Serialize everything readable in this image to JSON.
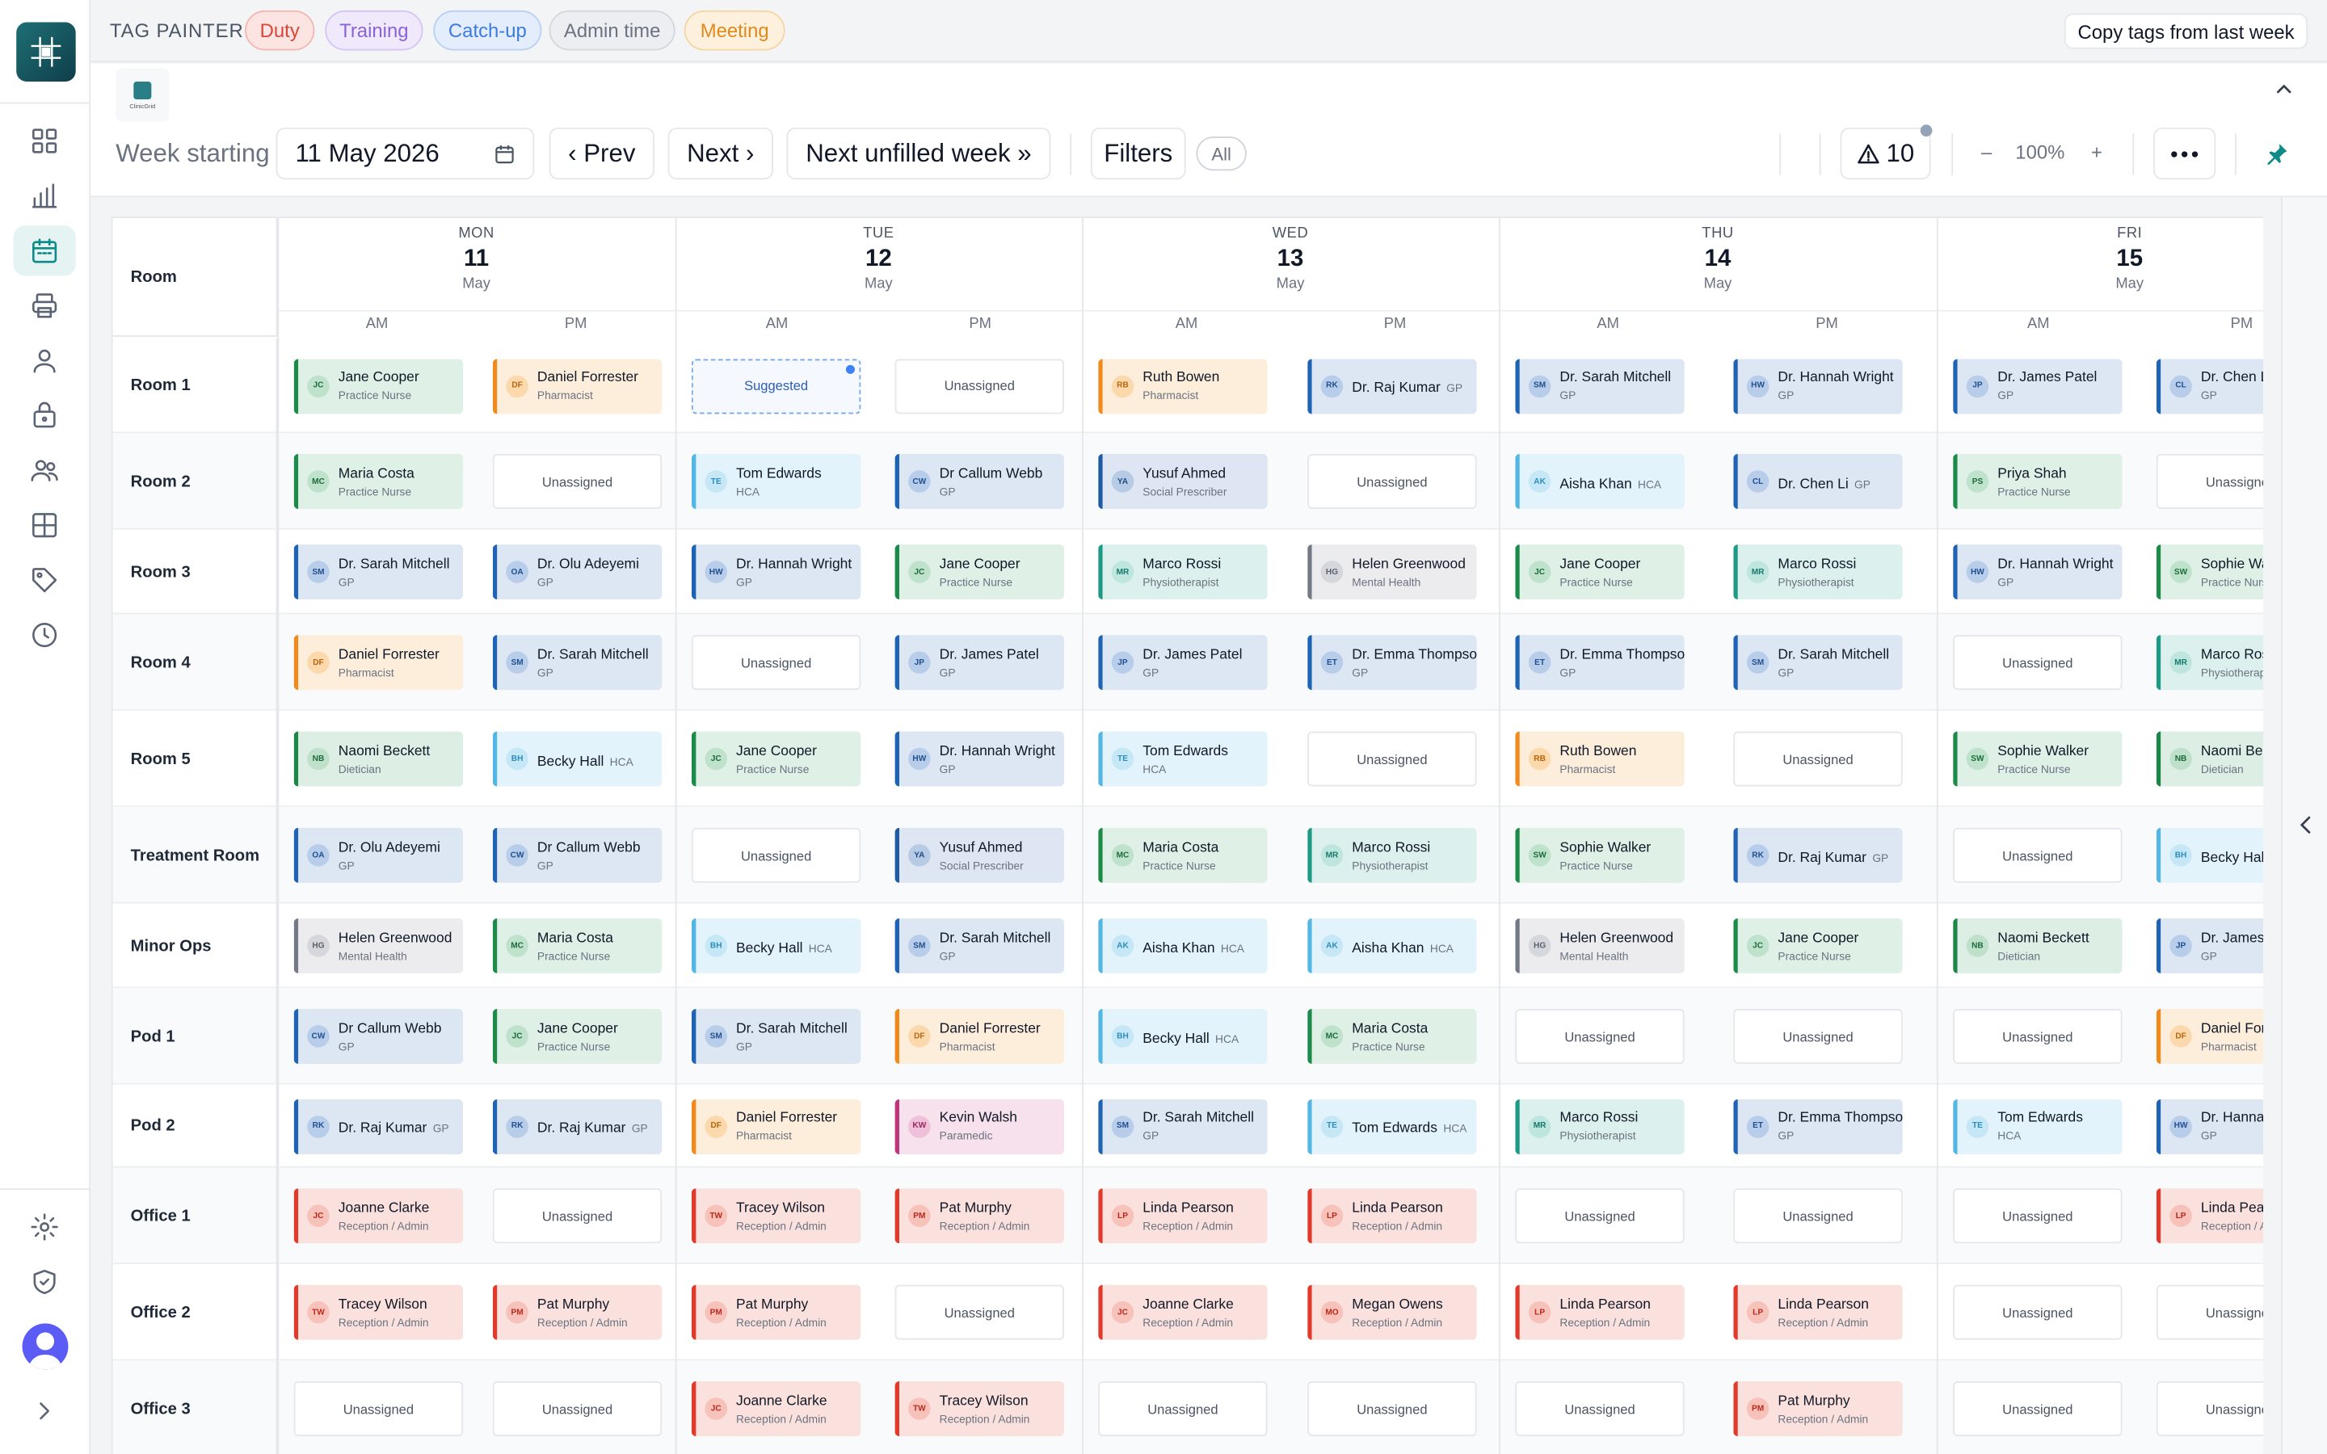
{
  "tag_painter": {
    "title": "TAG PAINTER",
    "tags": [
      "Duty",
      "Training",
      "Catch-up",
      "Admin time",
      "Meeting"
    ],
    "copy_button": "Copy tags from last week"
  },
  "toolbar": {
    "brand_caption": "ClinicGrid",
    "week_label": "Week starting",
    "week_value": "11 May 2026",
    "prev": "‹ Prev",
    "next": "Next ›",
    "next_unfilled": "Next unfilled week »",
    "filters": "Filters",
    "filter_chip": "All",
    "alerts_count": "10",
    "zoom_minus": "–",
    "zoom_value": "100%",
    "zoom_plus": "+"
  },
  "rail": {
    "items": [
      "grid-icon",
      "chart-icon",
      "calendar-icon",
      "printer-icon",
      "user-icon",
      "briefcase-icon",
      "users-icon",
      "layout-icon",
      "tag-icon",
      "clock-icon"
    ],
    "bottom": [
      "settings-icon",
      "shield-icon",
      "avatar",
      "expand-icon"
    ]
  },
  "grid": {
    "room_header": "Room",
    "half_am": "AM",
    "half_pm": "PM",
    "days": [
      {
        "dow": "MON",
        "num": "11",
        "mon": "May"
      },
      {
        "dow": "TUE",
        "num": "12",
        "mon": "May"
      },
      {
        "dow": "WED",
        "num": "13",
        "mon": "May"
      },
      {
        "dow": "THU",
        "num": "14",
        "mon": "May"
      },
      {
        "dow": "FRI",
        "num": "15",
        "mon": "May"
      }
    ],
    "rows": [
      {
        "room": "Room 1",
        "cells": [
          {
            "n": "Jane Cooper",
            "r": "Practice Nurse"
          },
          {
            "n": "Daniel Forrester",
            "r": "Pharmacist"
          },
          {
            "s": "Suggested"
          },
          {
            "u": "Unassigned"
          },
          {
            "n": "Ruth Bowen",
            "r": "Pharmacist"
          },
          {
            "n": "Dr. Raj Kumar",
            "r": "GP",
            "inline": true
          },
          {
            "n": "Dr. Sarah Mitchell",
            "r": "GP"
          },
          {
            "n": "Dr. Hannah Wright",
            "r": "GP"
          },
          {
            "n": "Dr. James Patel",
            "r": "GP"
          },
          {
            "n": "Dr. Chen Li",
            "r": "GP"
          }
        ]
      },
      {
        "room": "Room 2",
        "cells": [
          {
            "n": "Maria Costa",
            "r": "Practice Nurse"
          },
          {
            "u": "Unassigned"
          },
          {
            "n": "Tom Edwards",
            "r": "HCA"
          },
          {
            "n": "Dr Callum Webb",
            "r": "GP"
          },
          {
            "n": "Yusuf Ahmed",
            "r": "Social Prescriber"
          },
          {
            "u": "Unassigned"
          },
          {
            "n": "Aisha Khan",
            "r": "HCA",
            "inline": true
          },
          {
            "n": "Dr. Chen Li",
            "r": "GP",
            "inline": true
          },
          {
            "n": "Priya Shah",
            "r": "Practice Nurse"
          },
          {
            "u": "Unassigned"
          }
        ]
      },
      {
        "room": "Room 3",
        "cells": [
          {
            "n": "Dr. Sarah Mitchell",
            "r": "GP"
          },
          {
            "n": "Dr. Olu Adeyemi",
            "r": "GP"
          },
          {
            "n": "Dr. Hannah Wright",
            "r": "GP"
          },
          {
            "n": "Jane Cooper",
            "r": "Practice Nurse"
          },
          {
            "n": "Marco Rossi",
            "r": "Physiotherapist"
          },
          {
            "n": "Helen Greenwood",
            "r": "Mental Health"
          },
          {
            "n": "Jane Cooper",
            "r": "Practice Nurse"
          },
          {
            "n": "Marco Rossi",
            "r": "Physiotherapist"
          },
          {
            "n": "Dr. Hannah Wright",
            "r": "GP"
          },
          {
            "n": "Sophie Walker",
            "r": "Practice Nurse"
          }
        ]
      },
      {
        "room": "Room 4",
        "cells": [
          {
            "n": "Daniel Forrester",
            "r": "Pharmacist"
          },
          {
            "n": "Dr. Sarah Mitchell",
            "r": "GP"
          },
          {
            "u": "Unassigned"
          },
          {
            "n": "Dr. James Patel",
            "r": "GP"
          },
          {
            "n": "Dr. James Patel",
            "r": "GP"
          },
          {
            "n": "Dr. Emma Thompson",
            "r": "GP"
          },
          {
            "n": "Dr. Emma Thompson",
            "r": "GP"
          },
          {
            "n": "Dr. Sarah Mitchell",
            "r": "GP"
          },
          {
            "u": "Unassigned"
          },
          {
            "n": "Marco Rossi",
            "r": "Physiotherapist"
          }
        ]
      },
      {
        "room": "Room 5",
        "cells": [
          {
            "n": "Naomi Beckett",
            "r": "Dietician"
          },
          {
            "n": "Becky Hall",
            "r": "HCA",
            "inline": true
          },
          {
            "n": "Jane Cooper",
            "r": "Practice Nurse"
          },
          {
            "n": "Dr. Hannah Wright",
            "r": "GP"
          },
          {
            "n": "Tom Edwards",
            "r": "HCA"
          },
          {
            "u": "Unassigned"
          },
          {
            "n": "Ruth Bowen",
            "r": "Pharmacist"
          },
          {
            "u": "Unassigned"
          },
          {
            "n": "Sophie Walker",
            "r": "Practice Nurse"
          },
          {
            "n": "Naomi Beckett",
            "r": "Dietician"
          }
        ]
      },
      {
        "room": "Treatment Room",
        "cells": [
          {
            "n": "Dr. Olu Adeyemi",
            "r": "GP"
          },
          {
            "n": "Dr Callum Webb",
            "r": "GP"
          },
          {
            "u": "Unassigned"
          },
          {
            "n": "Yusuf Ahmed",
            "r": "Social Prescriber"
          },
          {
            "n": "Maria Costa",
            "r": "Practice Nurse"
          },
          {
            "n": "Marco Rossi",
            "r": "Physiotherapist"
          },
          {
            "n": "Sophie Walker",
            "r": "Practice Nurse"
          },
          {
            "n": "Dr. Raj Kumar",
            "r": "GP",
            "inline": true
          },
          {
            "u": "Unassigned"
          },
          {
            "n": "Becky Hall",
            "r": "HCA",
            "inline": true
          }
        ]
      },
      {
        "room": "Minor Ops",
        "cells": [
          {
            "n": "Helen Greenwood",
            "r": "Mental Health"
          },
          {
            "n": "Maria Costa",
            "r": "Practice Nurse"
          },
          {
            "n": "Becky Hall",
            "r": "HCA",
            "inline": true
          },
          {
            "n": "Dr. Sarah Mitchell",
            "r": "GP"
          },
          {
            "n": "Aisha Khan",
            "r": "HCA",
            "inline": true
          },
          {
            "n": "Aisha Khan",
            "r": "HCA",
            "inline": true
          },
          {
            "n": "Helen Greenwood",
            "r": "Mental Health"
          },
          {
            "n": "Jane Cooper",
            "r": "Practice Nurse"
          },
          {
            "n": "Naomi Beckett",
            "r": "Dietician"
          },
          {
            "n": "Dr. James Patel",
            "r": "GP"
          }
        ]
      },
      {
        "room": "Pod 1",
        "cells": [
          {
            "n": "Dr Callum Webb",
            "r": "GP"
          },
          {
            "n": "Jane Cooper",
            "r": "Practice Nurse"
          },
          {
            "n": "Dr. Sarah Mitchell",
            "r": "GP"
          },
          {
            "n": "Daniel Forrester",
            "r": "Pharmacist"
          },
          {
            "n": "Becky Hall",
            "r": "HCA",
            "inline": true
          },
          {
            "n": "Maria Costa",
            "r": "Practice Nurse"
          },
          {
            "u": "Unassigned"
          },
          {
            "u": "Unassigned"
          },
          {
            "u": "Unassigned"
          },
          {
            "n": "Daniel Forrester",
            "r": "Pharmacist"
          }
        ]
      },
      {
        "room": "Pod 2",
        "cells": [
          {
            "n": "Dr. Raj Kumar",
            "r": "GP",
            "inline": true
          },
          {
            "n": "Dr. Raj Kumar",
            "r": "GP",
            "inline": true
          },
          {
            "n": "Daniel Forrester",
            "r": "Pharmacist"
          },
          {
            "n": "Kevin Walsh",
            "r": "Paramedic"
          },
          {
            "n": "Dr. Sarah Mitchell",
            "r": "GP"
          },
          {
            "n": "Tom Edwards",
            "r": "HCA",
            "inline": true
          },
          {
            "n": "Marco Rossi",
            "r": "Physiotherapist"
          },
          {
            "n": "Dr. Emma Thompson",
            "r": "GP"
          },
          {
            "n": "Tom Edwards",
            "r": "HCA"
          },
          {
            "n": "Dr. Hannah Wright",
            "r": "GP"
          }
        ]
      },
      {
        "room": "Office 1",
        "cells": [
          {
            "n": "Joanne Clarke",
            "r": "Reception / Admin"
          },
          {
            "u": "Unassigned"
          },
          {
            "n": "Tracey Wilson",
            "r": "Reception / Admin"
          },
          {
            "n": "Pat Murphy",
            "r": "Reception / Admin"
          },
          {
            "n": "Linda Pearson",
            "r": "Reception / Admin"
          },
          {
            "n": "Linda Pearson",
            "r": "Reception / Admin"
          },
          {
            "u": "Unassigned"
          },
          {
            "u": "Unassigned"
          },
          {
            "u": "Unassigned"
          },
          {
            "n": "Linda Pearson",
            "r": "Reception / Admin"
          }
        ]
      },
      {
        "room": "Office 2",
        "cells": [
          {
            "n": "Tracey Wilson",
            "r": "Reception / Admin"
          },
          {
            "n": "Pat Murphy",
            "r": "Reception / Admin"
          },
          {
            "n": "Pat Murphy",
            "r": "Reception / Admin"
          },
          {
            "u": "Unassigned"
          },
          {
            "n": "Joanne Clarke",
            "r": "Reception / Admin"
          },
          {
            "n": "Megan Owens",
            "r": "Reception / Admin"
          },
          {
            "n": "Linda Pearson",
            "r": "Reception / Admin"
          },
          {
            "n": "Linda Pearson",
            "r": "Reception / Admin"
          },
          {
            "u": "Unassigned"
          },
          {
            "u": "Unassigned"
          }
        ]
      },
      {
        "room": "Office 3",
        "cells": [
          {
            "u": "Unassigned"
          },
          {
            "u": "Unassigned"
          },
          {
            "n": "Joanne Clarke",
            "r": "Reception / Admin"
          },
          {
            "n": "Tracey Wilson",
            "r": "Reception / Admin"
          },
          {
            "u": "Unassigned"
          },
          {
            "u": "Unassigned"
          },
          {
            "u": "Unassigned"
          },
          {
            "n": "Pat Murphy",
            "r": "Reception / Admin"
          },
          {
            "u": "Unassigned"
          },
          {
            "u": "Unassigned"
          }
        ]
      }
    ]
  },
  "role_colors": {
    "GP": {
      "bg": "#dde7f3",
      "bar": "#1f63b5",
      "av": "#b8cdea",
      "avt": "#1f4f8f"
    },
    "Practice Nurse": {
      "bg": "#dff0e6",
      "bar": "#1c8a48",
      "av": "#bfe2cc",
      "avt": "#1c6b3b"
    },
    "Pharmacist": {
      "bg": "#fdeedb",
      "bar": "#f08a1c",
      "av": "#fbd9ad",
      "avt": "#b8650e"
    },
    "HCA": {
      "bg": "#e3f3fb",
      "bar": "#53b6e3",
      "av": "#c6e7f6",
      "avt": "#2b8dba"
    },
    "Reception / Admin": {
      "bg": "#fbe1dd",
      "bar": "#e23a2a",
      "av": "#f7c2ba",
      "avt": "#b8291c"
    },
    "Physiotherapist": {
      "bg": "#dcf1ee",
      "bar": "#1d9a86",
      "av": "#bee5de",
      "avt": "#17796a"
    },
    "Mental Health": {
      "bg": "#ececef",
      "bar": "#737985",
      "av": "#d6d7dc",
      "avt": "#5b606b"
    },
    "Social Prescriber": {
      "bg": "#dde6f2",
      "bar": "#1f5aa5",
      "av": "#b8cbe5",
      "avt": "#1d4a86"
    },
    "Dietician": {
      "bg": "#ddefe4",
      "bar": "#1c8647",
      "av": "#bfe0cb",
      "avt": "#1c6b3b"
    },
    "Paramedic": {
      "bg": "#f6e1ec",
      "bar": "#c0347c",
      "av": "#efc1d9",
      "avt": "#9b2764"
    }
  },
  "tag_colors": [
    "#fbe4e2",
    "#f0e9fb",
    "#e3edfb",
    "#eceef1",
    "#fdf0dd"
  ]
}
